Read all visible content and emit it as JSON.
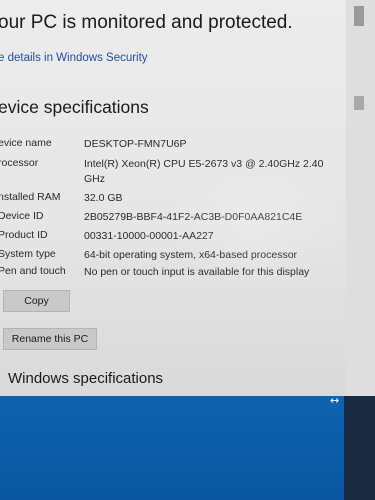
{
  "header": {
    "headline": "our PC is monitored and protected.",
    "security_link": "e details in Windows Security"
  },
  "device_specifications": {
    "title": "evice specifications",
    "rows": [
      {
        "label": "evice name",
        "value": "DESKTOP-FMN7U6P"
      },
      {
        "label": "rocessor",
        "value": "Intel(R) Xeon(R) CPU E5-2673 v3 @ 2.40GHz   2.40 GHz"
      },
      {
        "label": "nstalled RAM",
        "value": "32.0 GB"
      },
      {
        "label": "Device ID",
        "value": "2B05279B-BBF4-41F2-AC3B-D0F0AA821C4E"
      },
      {
        "label": "Product ID",
        "value": "00331-10000-00001-AA227"
      },
      {
        "label": "System type",
        "value": "64-bit operating system, x64-based processor"
      },
      {
        "label": "Pen and touch",
        "value": "No pen or touch input is available for this display"
      }
    ]
  },
  "buttons": {
    "copy_label": "Copy",
    "rename_label": "Rename this PC"
  },
  "windows_specifications": {
    "title": "Windows specifications"
  },
  "cursor": {
    "glyph": "↔"
  },
  "colors": {
    "link": "#1d4e9e",
    "button_bg": "#c9c9c9",
    "desktop_bg": "#0d5fa8",
    "window_bg": "#e6e6e6"
  }
}
